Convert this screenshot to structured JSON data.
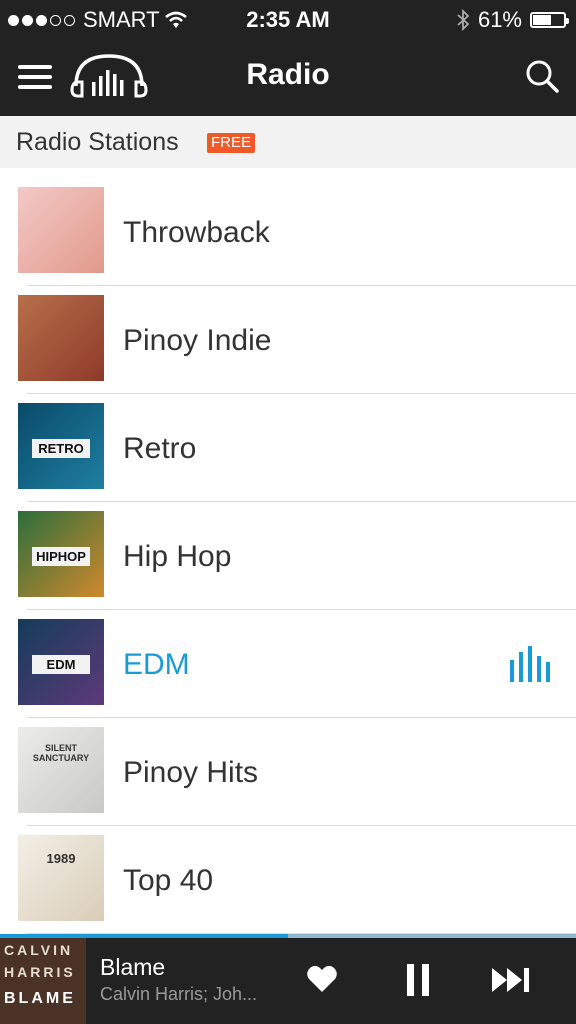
{
  "status_bar": {
    "carrier": "SMART",
    "time": "2:35 AM",
    "battery_percent": "61%",
    "battery_level": 0.61,
    "signal_dots_filled": 3,
    "signal_dots_total": 5,
    "icons": [
      "wifi-icon",
      "bluetooth-icon",
      "battery-icon"
    ]
  },
  "nav": {
    "title": "Radio",
    "menu_icon": "hamburger-menu-icon",
    "logo_icon": "headphones-equalizer-logo",
    "search_icon": "search-icon"
  },
  "section": {
    "title": "Radio Stations",
    "badge": "FREE"
  },
  "stations": [
    {
      "name": "Throwback",
      "active": false,
      "art_text": "",
      "art_colors": [
        "#f3c9c8",
        "#e29a8a"
      ]
    },
    {
      "name": "Pinoy Indie",
      "active": false,
      "art_text": "",
      "art_colors": [
        "#b7704a",
        "#8f3a2a"
      ]
    },
    {
      "name": "Retro",
      "active": false,
      "art_text": "RETRO",
      "art_colors": [
        "#0a4a6a",
        "#1e7fa0"
      ]
    },
    {
      "name": "Hip Hop",
      "active": false,
      "art_text": "HIPHOP",
      "art_colors": [
        "#2c6e3c",
        "#d0892c"
      ]
    },
    {
      "name": "EDM",
      "active": true,
      "art_text": "EDM",
      "art_colors": [
        "#143c5a",
        "#5d3a7a"
      ]
    },
    {
      "name": "Pinoy Hits",
      "active": false,
      "art_text": "SILENT SANCTUARY",
      "art_colors": [
        "#ececea",
        "#c9c9c6"
      ]
    },
    {
      "name": "Top 40",
      "active": false,
      "art_text": "1989",
      "art_colors": [
        "#f3efe6",
        "#d9cdb8"
      ]
    }
  ],
  "now_playing": {
    "song": "Blame",
    "artist": "Calvin Harris; Joh...",
    "art_lines": [
      "CALVIN",
      "HARRIS",
      "BLAME"
    ],
    "progress": 0.5,
    "controls": [
      "heart-icon",
      "pause-icon",
      "next-track-icon"
    ]
  },
  "colors": {
    "bar_bg": "#222222",
    "accent": "#1a9bd7",
    "badge": "#f05a28"
  }
}
